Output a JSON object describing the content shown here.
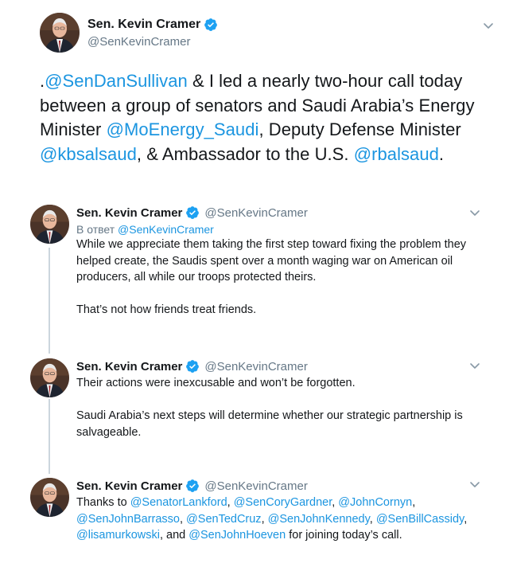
{
  "main": {
    "name": "Sen. Kevin Cramer",
    "handle": "@SenKevinCramer",
    "text_segments": [
      {
        "t": ".",
        "link": false
      },
      {
        "t": "@SenDanSullivan",
        "link": true
      },
      {
        "t": " & I led a nearly two-hour call today between a group of senators and Saudi Arabia’s Energy Minister ",
        "link": false
      },
      {
        "t": "@MoEnergy_Saudi",
        "link": true
      },
      {
        "t": ", Deputy Defense Minister ",
        "link": false
      },
      {
        "t": "@kbsalsaud",
        "link": true
      },
      {
        "t": ", & Ambassador to the U.S. ",
        "link": false
      },
      {
        "t": "@rbalsaud",
        "link": true
      },
      {
        "t": ".",
        "link": false
      }
    ]
  },
  "replies": [
    {
      "name": "Sen. Kevin Cramer",
      "handle": "@SenKevinCramer",
      "reply_to_label": "В ответ",
      "reply_to_handle": "@SenKevinCramer",
      "paragraphs": [
        [
          {
            "t": "While we appreciate them taking the first step toward fixing the problem they helped create, the Saudis spent over a month waging war on American oil producers, all while our troops protected theirs.",
            "link": false
          }
        ],
        [
          {
            "t": "That’s not how friends treat friends.",
            "link": false
          }
        ]
      ]
    },
    {
      "name": "Sen. Kevin Cramer",
      "handle": "@SenKevinCramer",
      "paragraphs": [
        [
          {
            "t": "Their actions were inexcusable and won’t be forgotten.",
            "link": false
          }
        ],
        [
          {
            "t": "Saudi Arabia’s next steps will determine whether our strategic partnership is salvageable.",
            "link": false
          }
        ]
      ]
    },
    {
      "name": "Sen. Kevin Cramer",
      "handle": "@SenKevinCramer",
      "paragraphs": [
        [
          {
            "t": "Thanks to ",
            "link": false
          },
          {
            "t": "@SenatorLankford",
            "link": true
          },
          {
            "t": ", ",
            "link": false
          },
          {
            "t": "@SenCoryGardner",
            "link": true
          },
          {
            "t": ", ",
            "link": false
          },
          {
            "t": "@JohnCornyn",
            "link": true
          },
          {
            "t": ", ",
            "link": false
          },
          {
            "t": "@SenJohnBarrasso",
            "link": true
          },
          {
            "t": ", ",
            "link": false
          },
          {
            "t": "@SenTedCruz",
            "link": true
          },
          {
            "t": ", ",
            "link": false
          },
          {
            "t": "@SenJohnKennedy",
            "link": true
          },
          {
            "t": ", ",
            "link": false
          },
          {
            "t": "@SenBillCassidy",
            "link": true
          },
          {
            "t": ", ",
            "link": false
          },
          {
            "t": "@lisamurkowski",
            "link": true
          },
          {
            "t": ", and ",
            "link": false
          },
          {
            "t": "@SenJohnHoeven",
            "link": true
          },
          {
            "t": " for joining today’s call.",
            "link": false
          }
        ]
      ]
    }
  ],
  "icons": {
    "verified": "verified-badge-icon",
    "caret": "chevron-down-icon",
    "avatar": "profile-photo"
  },
  "colors": {
    "text": "#14171a",
    "secondary": "#657786",
    "link": "#1b95e0",
    "verified": "#1da1f2",
    "thread_line": "#ccd6dd"
  }
}
